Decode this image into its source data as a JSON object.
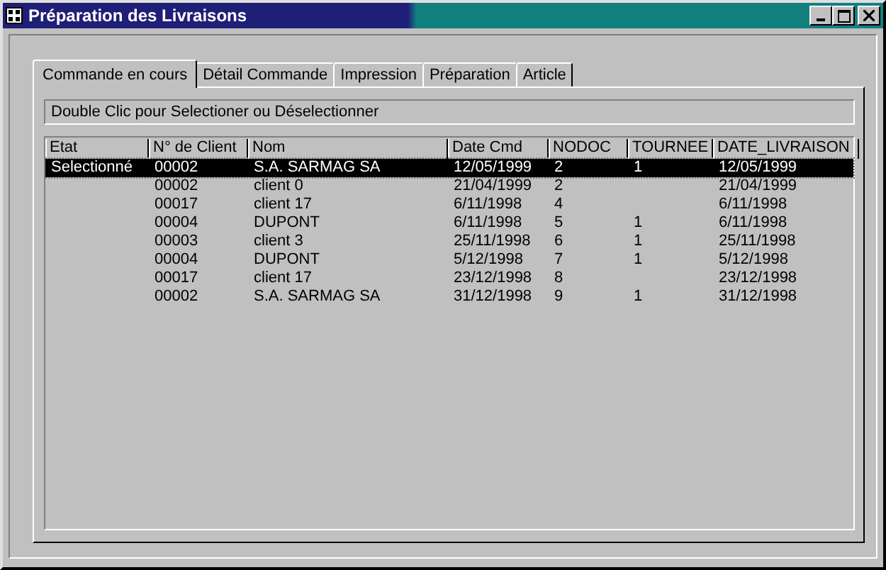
{
  "window": {
    "title": "Préparation des Livraisons"
  },
  "tabs": [
    {
      "label": "Commande en cours",
      "selected": true
    },
    {
      "label": "Détail Commande",
      "selected": false
    },
    {
      "label": "Impression",
      "selected": false
    },
    {
      "label": "Préparation",
      "selected": false
    },
    {
      "label": "Article",
      "selected": false
    }
  ],
  "hint": "Double Clic pour Selectioner ou Déselectionner",
  "table": {
    "columns": [
      "Etat",
      "N° de Client",
      "Nom",
      "Date Cmd",
      "NODOC",
      "TOURNEE",
      "DATE_LIVRAISON"
    ],
    "rows": [
      {
        "selected": true,
        "cells": [
          "Selectionné",
          "00002",
          "S.A. SARMAG SA",
          "12/05/1999",
          "2",
          "1",
          "12/05/1999"
        ]
      },
      {
        "selected": false,
        "cells": [
          null,
          "00002",
          "client 0",
          "21/04/1999",
          "2",
          null,
          "21/04/1999"
        ]
      },
      {
        "selected": false,
        "cells": [
          null,
          "00017",
          "client 17",
          "6/11/1998",
          "4",
          null,
          "6/11/1998"
        ]
      },
      {
        "selected": false,
        "cells": [
          null,
          "00004",
          "DUPONT",
          "6/11/1998",
          "5",
          "1",
          "6/11/1998"
        ]
      },
      {
        "selected": false,
        "cells": [
          null,
          "00003",
          "client 3",
          "25/11/1998",
          "6",
          "1",
          "25/11/1998"
        ]
      },
      {
        "selected": false,
        "cells": [
          null,
          "00004",
          "DUPONT",
          "5/12/1998",
          "7",
          "1",
          "5/12/1998"
        ]
      },
      {
        "selected": false,
        "cells": [
          null,
          "00017",
          "client 17",
          "23/12/1998",
          "8",
          null,
          "23/12/1998"
        ]
      },
      {
        "selected": false,
        "cells": [
          null,
          "00002",
          "S.A. SARMAG SA",
          "31/12/1998",
          "9",
          "1",
          "31/12/1998"
        ]
      }
    ]
  }
}
